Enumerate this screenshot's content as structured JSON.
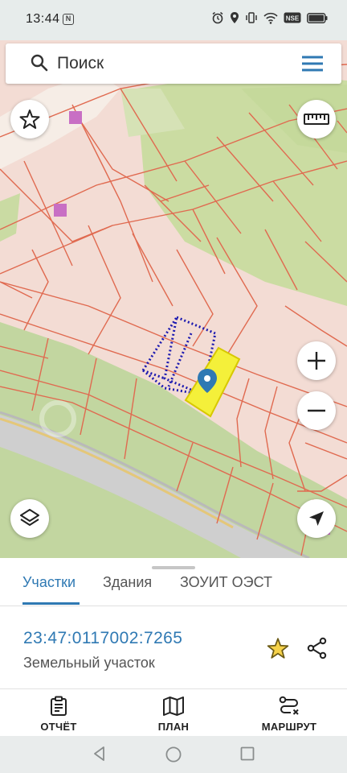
{
  "status_bar": {
    "time": "13:44",
    "notification_badge": "N",
    "icons": [
      "alarm-icon",
      "location-icon",
      "vibrate-icon",
      "wifi-icon",
      "data-saver-icon",
      "battery-icon"
    ]
  },
  "search": {
    "placeholder": "Поиск"
  },
  "map": {
    "controls": [
      "favorites-star-icon",
      "ruler-icon",
      "zoom-in-icon",
      "zoom-out-icon",
      "layers-icon",
      "navigation-arrow-icon"
    ],
    "colors": {
      "background": "#f3dcd4",
      "vegetation": "#cadca0",
      "parcel_borders": "#e06a50",
      "selected_parcel": "#f4f03a",
      "dotted_parcel": "#1c1ab0",
      "marker": "#2f79b3"
    }
  },
  "tabs": {
    "items": [
      {
        "label": "Участки",
        "active": true
      },
      {
        "label": "Здания",
        "active": false
      },
      {
        "label": "ЗОУИТ ОЭСТ",
        "active": false
      }
    ]
  },
  "parcel": {
    "cadastral_number": "23:47:0117002:7265",
    "type": "Земельный участок"
  },
  "actions": {
    "report": "ОТЧЁТ",
    "plan": "ПЛАН",
    "route": "МАРШРУТ"
  },
  "accent_color": "#2f79b3"
}
